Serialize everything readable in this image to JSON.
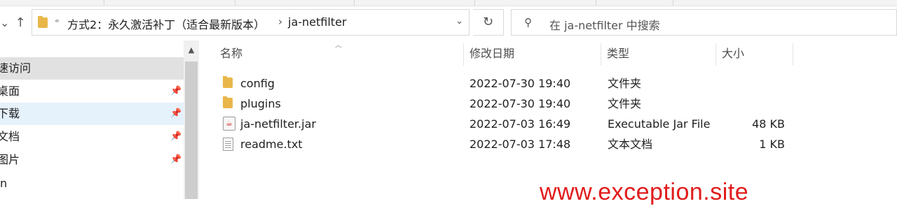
{
  "nav": {
    "back_icon": "chevron-down-icon",
    "up_icon": "arrow-up-icon"
  },
  "address": {
    "overflow": "«",
    "crumbs": [
      "方式2：永久激活补丁（适合最新版本）",
      "ja-netfilter"
    ],
    "separator": "›"
  },
  "search": {
    "placeholder": "在 ja-netfilter 中搜索"
  },
  "sidebar": {
    "items": [
      {
        "label": "速访问",
        "pinned": false
      },
      {
        "label": "桌面",
        "pinned": true
      },
      {
        "label": "下载",
        "pinned": true
      },
      {
        "label": "文档",
        "pinned": true
      },
      {
        "label": "图片",
        "pinned": true
      },
      {
        "label": "n",
        "pinned": false
      }
    ]
  },
  "columns": {
    "name": "名称",
    "date": "修改日期",
    "type": "类型",
    "size": "大小"
  },
  "files": [
    {
      "name": "config",
      "date": "2022-07-30 19:40",
      "type": "文件夹",
      "size": "",
      "icon": "folder-icon"
    },
    {
      "name": "plugins",
      "date": "2022-07-30 19:40",
      "type": "文件夹",
      "size": "",
      "icon": "folder-icon"
    },
    {
      "name": "ja-netfilter.jar",
      "date": "2022-07-03 16:49",
      "type": "Executable Jar File",
      "size": "48 KB",
      "icon": "java-jar-icon"
    },
    {
      "name": "readme.txt",
      "date": "2022-07-03 17:48",
      "type": "文本文档",
      "size": "1 KB",
      "icon": "text-file-icon"
    }
  ],
  "watermark": "www.exception.site",
  "colors": {
    "folder": "#e9b649",
    "selected_sidebar": "#e5f1fb",
    "active_sidebar": "#e1e1e1",
    "watermark": "#e11b1b"
  }
}
